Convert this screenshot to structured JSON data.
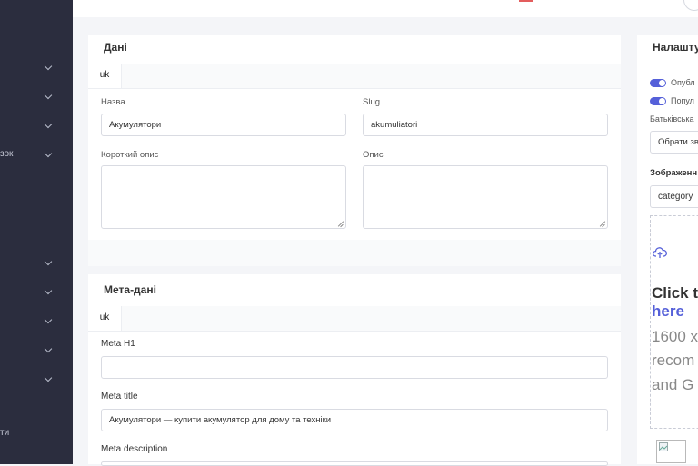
{
  "sidebar": {
    "items": [
      {
        "label": ""
      },
      {
        "label": ""
      },
      {
        "label": ""
      },
      {
        "label": "зок"
      },
      {
        "label": ""
      },
      {
        "label": ""
      },
      {
        "label": ""
      },
      {
        "label": ""
      },
      {
        "label": ""
      },
      {
        "label": "ти"
      }
    ]
  },
  "data_card": {
    "title": "Дані",
    "tab": "uk",
    "name_label": "Назва",
    "name_value": "Акумулятори",
    "slug_label": "Slug",
    "slug_value": "akumuliatori",
    "short_desc_label": "Короткий опис",
    "desc_label": "Опис"
  },
  "meta_card": {
    "title": "Мета-дані",
    "tab": "uk",
    "h1_label": "Meta H1",
    "h1_value": "",
    "title_label": "Meta title",
    "title_value": "Акумулятори — купити акумулятор для дому та техніки",
    "description_label": "Meta description"
  },
  "settings_card": {
    "title": "Налашту",
    "toggle_published_label": "Опубл",
    "toggle_popular_label": "Попул",
    "parent_label": "Батьківська",
    "parent_select": "Обрати зв",
    "image_label": "Зображенн",
    "image_input_value": "category",
    "dropzone": {
      "click_text": "Click t",
      "here_text": "here",
      "size_text": "1600 x",
      "recom_text": "recom",
      "formats_text": "and G"
    }
  },
  "colors": {
    "sidebar": "#2b2d3e",
    "accent": "#5560d9",
    "page_bg": "#f4f5f8"
  }
}
